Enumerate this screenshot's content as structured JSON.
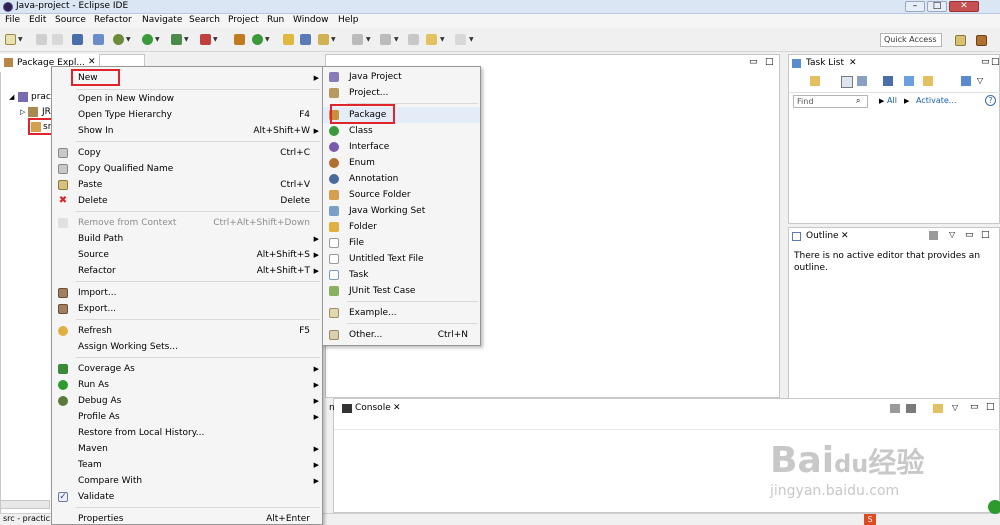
{
  "window": {
    "title": "Java-project - Eclipse IDE"
  },
  "menubar": [
    "File",
    "Edit",
    "Source",
    "Refactor",
    "Navigate",
    "Search",
    "Project",
    "Run",
    "Window",
    "Help"
  ],
  "toolbar": {
    "quick_access": "Quick Access"
  },
  "package_explorer": {
    "tab": "Package Expl...",
    "tree": [
      "practi",
      "JR",
      "sr"
    ]
  },
  "context_menu": [
    {
      "label": "New",
      "arrow": true
    },
    {
      "label": "Open in New Window"
    },
    {
      "label": "Open Type Hierarchy",
      "shortcut": "F4"
    },
    {
      "label": "Show In",
      "shortcut": "Alt+Shift+W",
      "arrow": true
    },
    {
      "label": "Copy",
      "shortcut": "Ctrl+C"
    },
    {
      "label": "Copy Qualified Name"
    },
    {
      "label": "Paste",
      "shortcut": "Ctrl+V"
    },
    {
      "label": "Delete",
      "shortcut": "Delete"
    },
    {
      "label": "Remove from Context",
      "shortcut": "Ctrl+Alt+Shift+Down",
      "disabled": true
    },
    {
      "label": "Build Path",
      "arrow": true
    },
    {
      "label": "Source",
      "shortcut": "Alt+Shift+S",
      "arrow": true
    },
    {
      "label": "Refactor",
      "shortcut": "Alt+Shift+T",
      "arrow": true
    },
    {
      "label": "Import..."
    },
    {
      "label": "Export..."
    },
    {
      "label": "Refresh",
      "shortcut": "F5"
    },
    {
      "label": "Assign Working Sets..."
    },
    {
      "label": "Coverage As",
      "arrow": true
    },
    {
      "label": "Run As",
      "arrow": true
    },
    {
      "label": "Debug As",
      "arrow": true
    },
    {
      "label": "Profile As",
      "arrow": true
    },
    {
      "label": "Restore from Local History..."
    },
    {
      "label": "Maven",
      "arrow": true
    },
    {
      "label": "Team",
      "arrow": true
    },
    {
      "label": "Compare With",
      "arrow": true
    },
    {
      "label": "Validate"
    },
    {
      "label": "Properties",
      "shortcut": "Alt+Enter"
    }
  ],
  "submenu": [
    {
      "label": "Java Project"
    },
    {
      "label": "Project..."
    },
    {
      "label": "Package"
    },
    {
      "label": "Class"
    },
    {
      "label": "Interface"
    },
    {
      "label": "Enum"
    },
    {
      "label": "Annotation"
    },
    {
      "label": "Source Folder"
    },
    {
      "label": "Java Working Set"
    },
    {
      "label": "Folder"
    },
    {
      "label": "File"
    },
    {
      "label": "Untitled Text File"
    },
    {
      "label": "Task"
    },
    {
      "label": "JUnit Test Case"
    },
    {
      "label": "Example..."
    },
    {
      "label": "Other...",
      "shortcut": "Ctrl+N"
    }
  ],
  "task_list": {
    "tab": "Task List",
    "find_placeholder": "Find",
    "all": "All",
    "activate": "Activate..."
  },
  "outline": {
    "tab": "Outline",
    "message": "There is no active editor that provides an outline."
  },
  "console": {
    "tab": "Console",
    "partial_tab": "n"
  },
  "statusbar": {
    "text": "src - practic"
  },
  "watermark": {
    "brand": "Bai",
    "paw": "du",
    "cn": "经验",
    "url": "jingyan.baidu.com"
  }
}
